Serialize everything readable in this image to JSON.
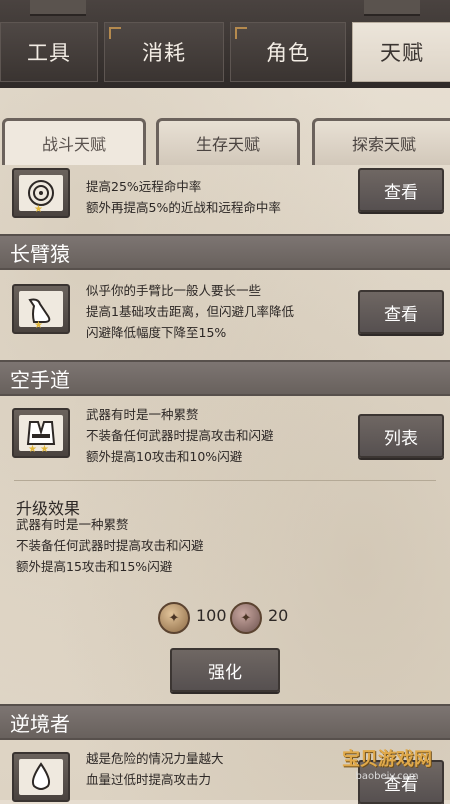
{
  "top_tabs": [
    "工具",
    "消耗",
    "角色",
    "天赋"
  ],
  "active_top_tab": "天赋",
  "sub_tabs": [
    "战斗天赋",
    "生存天赋",
    "探索天赋"
  ],
  "active_sub_tab": "战斗天赋",
  "talents": [
    {
      "title": "",
      "icon": "target-icon",
      "lines": [
        "提高25%远程命中率",
        "额外再提高5%的近战和远程命中率"
      ],
      "button": "查看",
      "stars": 1
    },
    {
      "title": "长臂猿",
      "icon": "long-arm-icon",
      "lines": [
        "似乎你的手臂比一般人要长一些",
        "提高1基础攻击距离，但闪避几率降低",
        "闪避降低幅度下降至15%"
      ],
      "button": "查看",
      "stars": 1
    },
    {
      "title": "空手道",
      "icon": "karate-uniform-icon",
      "lines": [
        "武器有时是一种累赘",
        "不装备任何武器时提高攻击和闪避",
        "额外提高10攻击和10%闪避"
      ],
      "button": "列表",
      "stars": 2
    },
    {
      "title": "逆境者",
      "icon": "blood-drop-icon",
      "lines": [
        "越是危险的情况力量越大",
        "血量过低时提高攻击力"
      ],
      "button": "查看",
      "stars": 0
    }
  ],
  "upgrade": {
    "title": "升级效果",
    "lines": [
      "武器有时是一种累赘",
      "不装备任何武器时提高攻击和闪避",
      "额外提高15攻击和15%闪避"
    ],
    "cost_a": "100",
    "cost_b": "20",
    "button": "强化"
  },
  "watermark": {
    "title": "宝贝游戏网",
    "sub": "baobeiy.com"
  }
}
